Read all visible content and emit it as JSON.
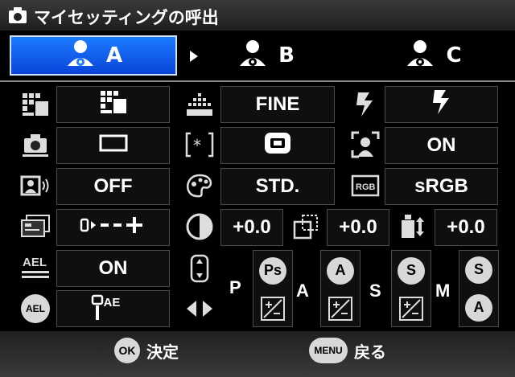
{
  "header": {
    "title": "マイセッティングの呼出",
    "icon": "camera-icon"
  },
  "tabs": [
    {
      "letter": "A",
      "icon": "myset-person-icon",
      "active": true
    },
    {
      "letter": "B",
      "icon": "myset-person-icon",
      "active": false
    },
    {
      "letter": "C",
      "icon": "myset-person-icon",
      "active": false
    }
  ],
  "settings": {
    "col1": {
      "aspect_value_icon": "aspect-grid-icon",
      "drive_value_icon": "single-frame-icon",
      "image_stabilizer": "OFF",
      "bracket_value_icon": "bracket-sequence-icon",
      "ael_lock": "ON",
      "ael_mode_icon": "ae-metering-icon"
    },
    "col2": {
      "quality": "FINE",
      "metering_value_icon": "metering-center-icon",
      "picture_mode": "STD.",
      "contrast": "+0.0",
      "sharpness": "+0.0",
      "saturation": "+0.0"
    },
    "col3": {
      "flash_value_icon": "flash-icon",
      "face_detect": "ON",
      "color_space": "sRGB"
    },
    "dial_labels": {
      "p": "P",
      "a": "A",
      "s": "S",
      "m": "M"
    },
    "dial_badges": {
      "p_top": "Ps",
      "a_top": "A",
      "s_top": "S",
      "m_top": "S",
      "m_bottom": "A"
    },
    "ael_badge": "AEL",
    "ael_underline_label": "AEL",
    "metering_sub": "AE"
  },
  "footer": {
    "ok_badge": "OK",
    "ok_label": "決定",
    "menu_badge": "MENU",
    "menu_label": "戻る"
  },
  "colors": {
    "active_tab": "#0a58f0",
    "background": "#000000",
    "box_border": "#4a4a4a"
  }
}
